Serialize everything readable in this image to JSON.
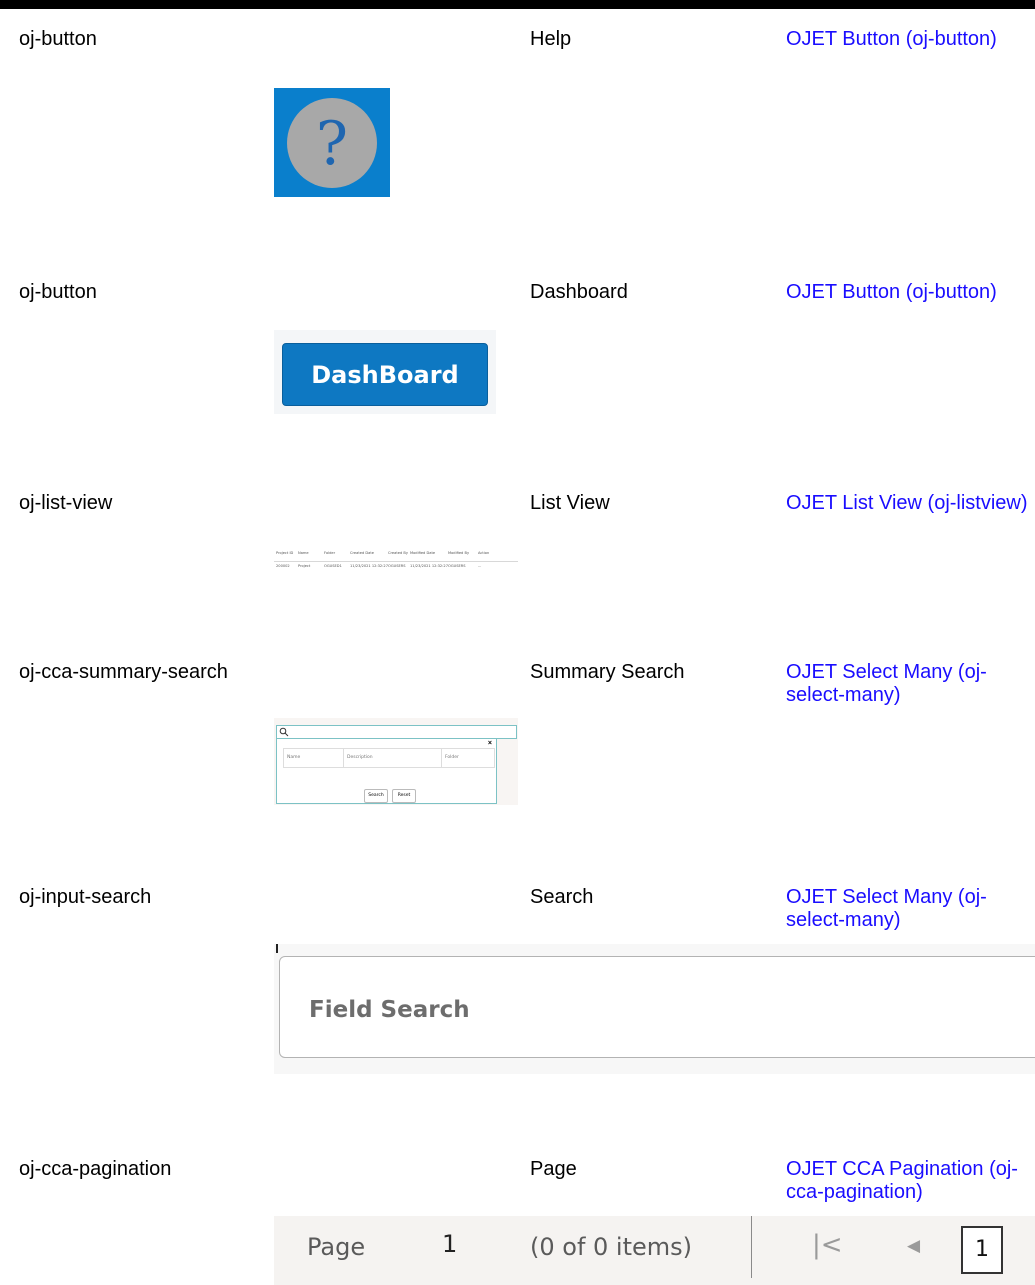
{
  "rows": [
    {
      "component": "oj-button",
      "name": "Help",
      "link": "OJET Button (oj-button)",
      "image": {
        "icon": "help-question-icon",
        "colors": {
          "background": "#0a7fcc",
          "circle": "#a8a8a8"
        }
      }
    },
    {
      "component": "oj-button",
      "name": "Dashboard",
      "link": "OJET Button (oj-button)",
      "image": {
        "button_label": "DashBoard",
        "colors": {
          "button": "#0e78c2"
        }
      }
    },
    {
      "component": "oj-list-view",
      "name": "List View",
      "link": "OJET List View (oj-listview)",
      "image": {
        "headers": [
          "Project ID",
          "Name",
          "Folder",
          "Created Date",
          "Created By",
          "Modified Date",
          "Modified By",
          "Action"
        ],
        "row": [
          "200002",
          "Project",
          "OGUSED1",
          "11/23/2021 12:32:27",
          "OGUSERS",
          "11/23/2021 12:32:27",
          "OGUSERS",
          "..."
        ]
      }
    },
    {
      "component": "oj-cca-summary-search",
      "name": "Summary Search",
      "link": "OJET Select Many (oj-select-many)",
      "image": {
        "search_icon": "search-icon",
        "close_icon": "close-icon",
        "columns": [
          "Name",
          "Description",
          "Folder"
        ],
        "search_button": "Search",
        "reset_button": "Reset"
      }
    },
    {
      "component": "oj-input-search",
      "name": "Search",
      "link": "OJET Select Many (oj-select-many)",
      "image": {
        "placeholder": "Field Search"
      }
    },
    {
      "component": "oj-cca-pagination",
      "name": "Page",
      "link": "OJET CCA Pagination (oj-cca-pagination)",
      "image": {
        "page_label": "Page",
        "page_number": "1",
        "items_text": "(0 of 0 items)",
        "first_icon": "first-page-icon",
        "prev_icon": "previous-page-icon",
        "current_page": "1"
      }
    }
  ]
}
